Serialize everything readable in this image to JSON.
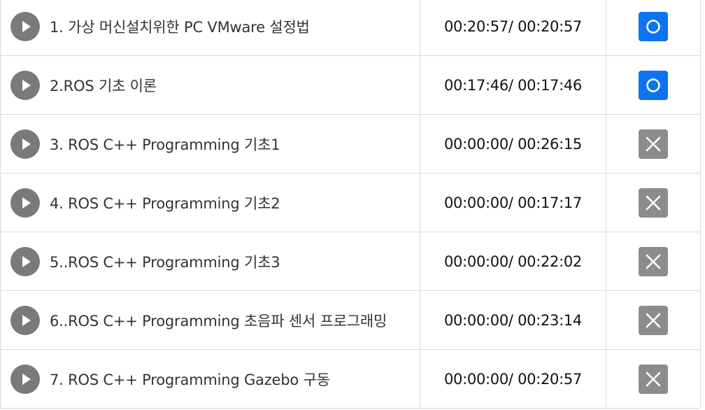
{
  "lectures": [
    {
      "title": "1. 가상 머신설치위한 PC VMware 설정법",
      "time": "00:20:57/ 00:20:57",
      "status": "done",
      "status_icon": "circle-icon"
    },
    {
      "title": "2.ROS 기초 이론",
      "time": "00:17:46/ 00:17:46",
      "status": "done",
      "status_icon": "circle-icon"
    },
    {
      "title": "3. ROS C++ Programming 기초1",
      "time": "00:00:00/ 00:26:15",
      "status": "todo",
      "status_icon": "x-icon"
    },
    {
      "title": "4. ROS C++ Programming 기초2",
      "time": "00:00:00/ 00:17:17",
      "status": "todo",
      "status_icon": "x-icon"
    },
    {
      "title": "5..ROS C++ Programming 기초3",
      "time": "00:00:00/ 00:22:02",
      "status": "todo",
      "status_icon": "x-icon"
    },
    {
      "title": "6..ROS C++ Programming 초음파 센서 프로그래밍",
      "time": "00:00:00/ 00:23:14",
      "status": "todo",
      "status_icon": "x-icon"
    },
    {
      "title": "7. ROS C++ Programming Gazebo 구동",
      "time": "00:00:00/ 00:20:57",
      "status": "todo",
      "status_icon": "x-icon"
    }
  ],
  "colors": {
    "play_button": "#7a7a7a",
    "done_badge": "#0d74f0",
    "todo_badge": "#8c8c8c"
  }
}
